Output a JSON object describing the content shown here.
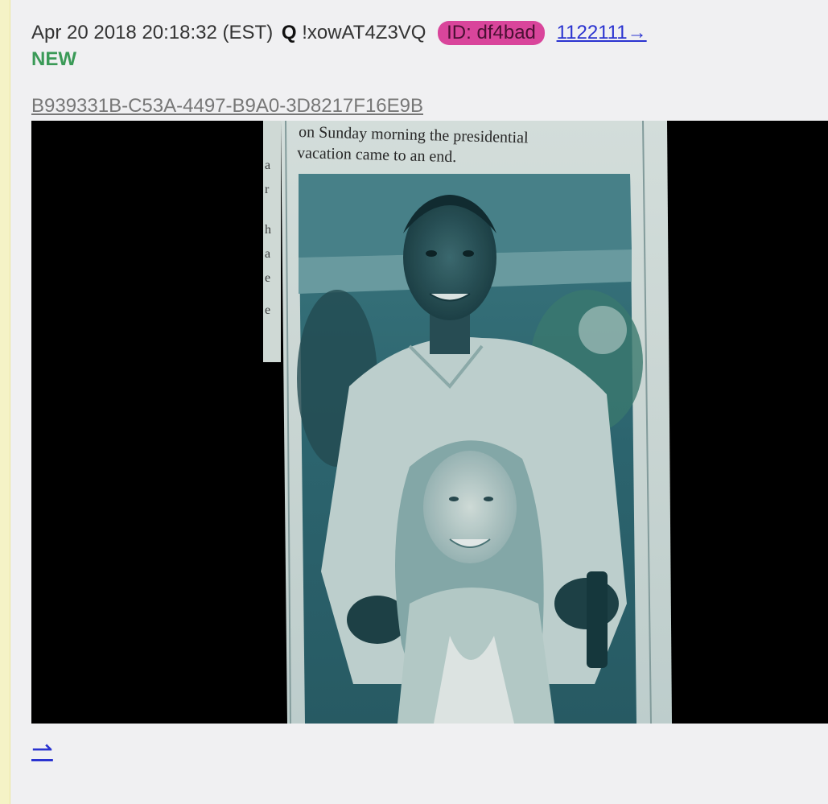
{
  "post": {
    "date": "Apr 20 2018 20:18:32 (EST)",
    "author": "Q",
    "tripcode": "!xowAT4Z3VQ",
    "id_badge": "ID: df4bad",
    "post_number": "1122111→",
    "new_tag": "NEW",
    "file_name": "B939331B-C53A-4497-B9A0-3D8217F16E9B",
    "backlink": "⇀"
  },
  "image": {
    "caption_line1": "on Sunday morning the presidential",
    "caption_line2": "vacation came to an end.",
    "tint_color": "#2f6a74",
    "background_color": "#000000"
  },
  "colors": {
    "id_badge": "#d9459b",
    "link": "#2a33d0",
    "new_tag": "#3a9a57",
    "post_bg": "#f0f0f2"
  }
}
